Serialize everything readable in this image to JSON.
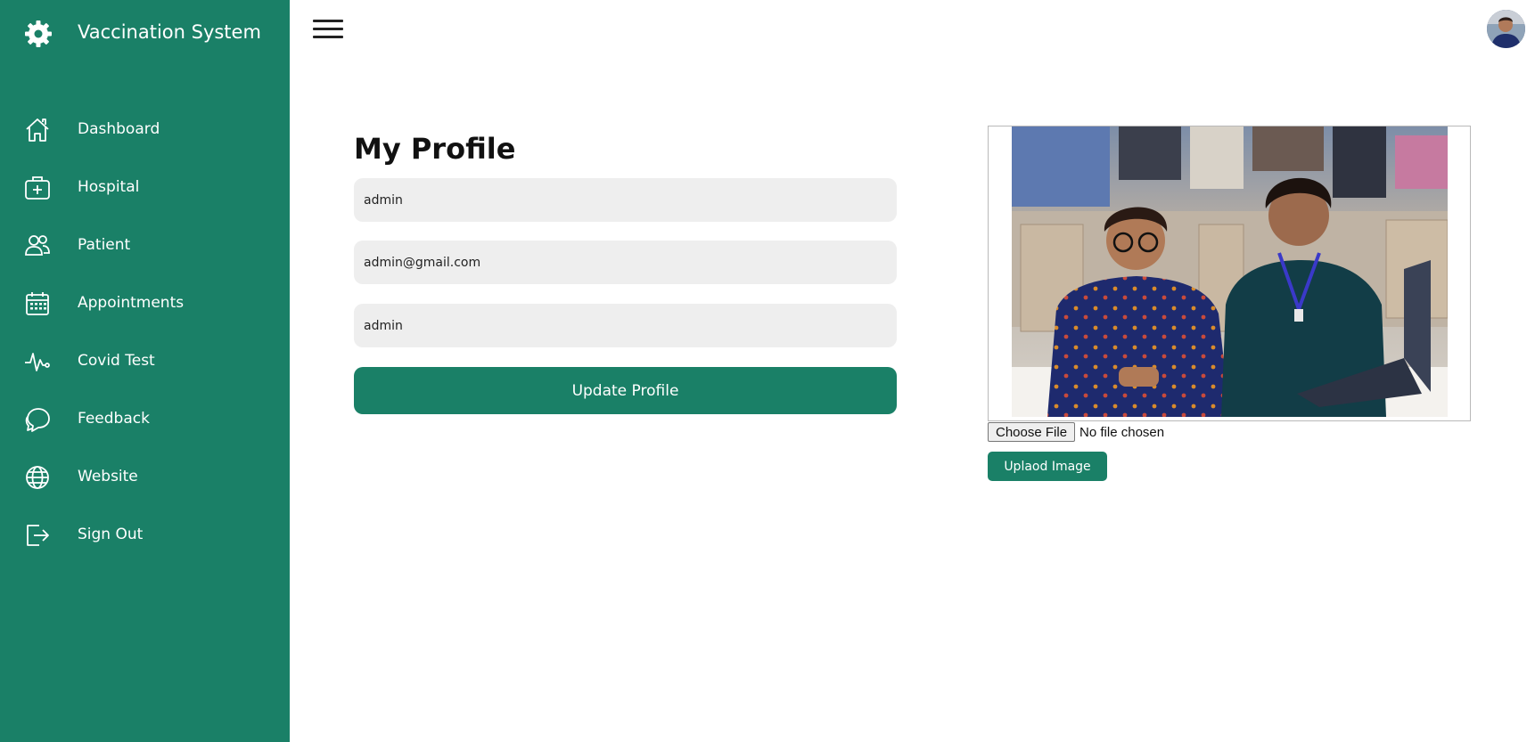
{
  "app": {
    "title": "Vaccination System",
    "brand_icon": "gear-icon"
  },
  "colors": {
    "primary": "#1a8067",
    "input_bg": "#eeeeee",
    "text": "#111111"
  },
  "sidebar": {
    "items": [
      {
        "label": "Dashboard",
        "icon": "home-icon"
      },
      {
        "label": "Hospital",
        "icon": "medical-case-icon"
      },
      {
        "label": "Patient",
        "icon": "users-icon"
      },
      {
        "label": "Appointments",
        "icon": "calendar-icon"
      },
      {
        "label": "Covid Test",
        "icon": "pulse-icon"
      },
      {
        "label": "Feedback",
        "icon": "chat-icon"
      },
      {
        "label": "Website",
        "icon": "globe-icon"
      },
      {
        "label": "Sign Out",
        "icon": "sign-out-icon"
      }
    ]
  },
  "topbar": {
    "menu_icon": "hamburger-icon",
    "avatar": "user-avatar"
  },
  "profile": {
    "heading": "My Profile",
    "name_value": "admin",
    "email_value": "admin@gmail.com",
    "password_value": "admin",
    "update_label": "Update Profile"
  },
  "image_panel": {
    "choose_file_label": "Choose File",
    "file_status": "No file chosen",
    "upload_label": "Uplaod Image"
  }
}
